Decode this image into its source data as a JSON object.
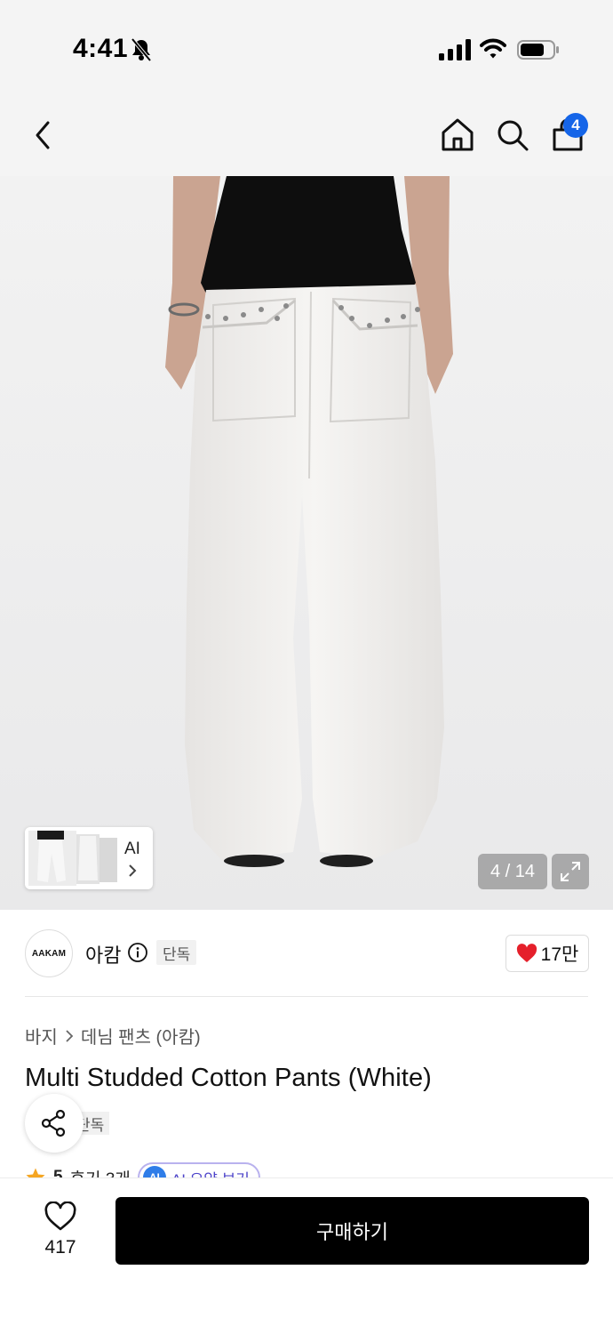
{
  "status_bar": {
    "time": "4:41",
    "icons": [
      "bell-slash-icon",
      "cellular-signal-icon",
      "wifi-icon",
      "battery-icon"
    ]
  },
  "nav": {
    "icons": [
      "back-chevron-icon",
      "home-icon",
      "search-icon",
      "shopping-bag-icon"
    ],
    "cart_count": "4"
  },
  "gallery": {
    "current_image": 4,
    "total_images": 14,
    "counter_text": "4 / 14",
    "thumbnail_ai_label": "AI"
  },
  "brand": {
    "logo_text": "AAKAM",
    "name": "아캄",
    "tag": "단독",
    "likes": "17만",
    "like_color": "#e5202b"
  },
  "product": {
    "breadcrumb": [
      "바지",
      "데님 팬츠 (아캄)"
    ],
    "title": "Multi Studded Cotton Pants (White)",
    "tag": "단독",
    "rating": "5",
    "reviews": "후기 3개",
    "ai_summary_label": "AI 요약 보기",
    "ai_badge": "AI"
  },
  "bottom_bar": {
    "wish_count": "417",
    "buy_label": "구매하기"
  },
  "colors": {
    "badge_blue": "#1565e8",
    "star": "#f5a623",
    "ai_purple": "#4d44c9",
    "buy_bg": "#000000"
  }
}
